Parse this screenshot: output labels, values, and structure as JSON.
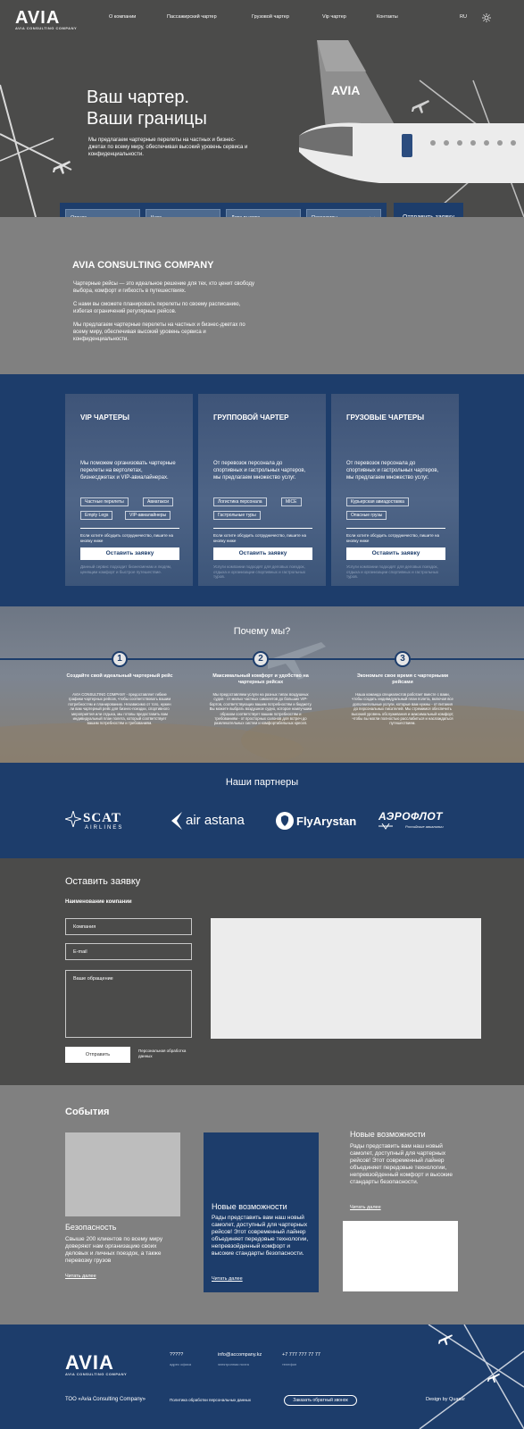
{
  "header": {
    "logo_text": "AVIA",
    "logo_sub": "AVIA CONSULTING COMPANY",
    "nav": [
      "О компании",
      "Пассажирский чартер",
      "Грузовой чартер",
      "Vip чартер",
      "Контакты"
    ],
    "lang": "RU"
  },
  "hero": {
    "title_line1": "Ваш чартер.",
    "title_line2": "Ваши границы",
    "subtitle": "Мы предлагаем чартерные перелеты на частных и бизнес-джетах по всему миру, обеспечивая высокий уровень сервиса и конфиденциальности.",
    "search": {
      "from": "Откуда",
      "to": "Куда",
      "date": "Дата вылета",
      "passengers": "Пассажиры",
      "submit": "Отправить заявку"
    }
  },
  "about": {
    "title": "AVIA CONSULTING COMPANY",
    "p1": "Чартерные рейсы — это идеальное решение для тех, кто ценит свободу выбора, комфорт и гибкость в путешествиях.",
    "p2": "С нами вы сможете планировать перелеты по своему расписанию, избегая ограничений регулярных рейсов.",
    "p3": "Мы предлагаем чартерные перелеты на частных и бизнес-джетах по всему миру, обеспечивая высокий уровень сервиса и конфиденциальности."
  },
  "services": [
    {
      "title": "VIP ЧАРТЕРЫ",
      "desc": "Мы поможем организовать чартерные перелеты на вертолетах, бизнесджетах и VIP-авиалайнерах.",
      "tags": [
        "Частные перелеты",
        "Авиатакси",
        "Empty Legs",
        "VIP-авиалайнеры"
      ],
      "note": "Если хотите обсудить сотрудничество, пишите на кнопку ниже",
      "button": "Оставить заявку",
      "footnote": "Данный сервис подходит бизнесменам и людям, ценящим комфорт и быстрое путешествие."
    },
    {
      "title": "ГРУППОВОЙ ЧАРТЕР",
      "desc": "От перевозок персонала до спортивных и гастрольных чартеров, мы предлагаем множество услуг.",
      "tags": [
        "Логистика персонала",
        "MICE",
        "Гастрольные туры"
      ],
      "note": "Если хотите обсудить сотрудничество, пишите на кнопку ниже",
      "button": "Оставить заявку",
      "footnote": "Услуги компании подходят для деловых поездок, отдыха и организации спортивных и гастрольных туров."
    },
    {
      "title": "ГРУЗОВЫЕ ЧАРТЕРЫ",
      "desc": "От перевозок персонала до спортивных и гастрольных чартеров, мы предлагаем множество услуг.",
      "tags": [
        "Курьерская авиадоставка",
        "Опасные грузы"
      ],
      "note": "Если хотите обсудить сотрудничество, пишите на кнопку ниже",
      "button": "Оставить заявку",
      "footnote": "Услуги компании подходят для деловых поездок, отдыха и организации спортивных и гастрольных туров."
    }
  ],
  "why": {
    "title": "Почему мы?",
    "items": [
      {
        "num": "1",
        "title": "Создайте свой идеальный чартерный рейс",
        "desc": "AVIA CONSULTING COMPANY - предоставляет гибкие графики чартерных рейсов, чтобы соответствовать вашим потребностям и планированию. Независимо от того, нужен ли вам чартерный рейс для бизнес-поездки, спортивного мероприятия или отдыха, мы готовы предоставить вам индивидуальный план полета, который соответствует вашим потребностям и требованиям."
      },
      {
        "num": "2",
        "title": "Максимальный комфорт и удобство на чартерных рейсах",
        "desc": "Мы предоставляем услуги на разных типах воздушных судов - от малых частных самолетов до больших VIP-бортов, соответствующих вашим потребностям и бюджету. Вы можете выбрать воздушное судно, которое наилучшим образом соответствует вашим потребностям и требованиям - от просторных салонов для встреч до развлекательных систем и комфортабельных кресел."
      },
      {
        "num": "3",
        "title": "Экономьте свое время с чартерными рейсами",
        "desc": "Наша команда специалистов работает вместе с вами, чтобы создать индивидуальный план полета, включая все дополнительные услуги, которые вам нужны - от питания до персональных писателей. Мы стремимся обеспечить высокий уровень обслуживания и максимальный комфорт, чтобы вы могли полностью расслабиться и наслаждаться путешествием."
      }
    ]
  },
  "partners": {
    "title": "Наши партнеры",
    "logos": [
      {
        "name": "SCAT",
        "sub": "AIRLINES"
      },
      {
        "name": "air astana",
        "sub": ""
      },
      {
        "name": "FlyArystan",
        "sub": ""
      },
      {
        "name": "АЭРОФЛОТ",
        "sub": "Российские авиалинии"
      }
    ]
  },
  "form": {
    "title": "Оставить заявку",
    "subtitle": "Наименование компании",
    "company_placeholder": "Компания",
    "email_placeholder": "E-mail",
    "message_placeholder": "Ваше обращение",
    "submit": "Отправить",
    "consent": "Персональная обработка данных"
  },
  "events": {
    "title": "События",
    "items": [
      {
        "title": "Безопасность",
        "text": "Свыше 200 клиентов по всему миру доверяют нам организацию своих деловых и личных поездок, а также перевозку грузов",
        "link": "Читать далее"
      },
      {
        "title": "Новые возможности",
        "text": "Рады представить вам наш новый самолет, доступный для чартерных рейсов! Этот современный лайнер объединяет передовые технологии, непревзойденный комфорт и высокие стандарты безопасности.",
        "link": "Читать далее"
      },
      {
        "title": "Новые возможности",
        "text": "Рады представить вам наш новый самолет, доступный для чартерных рейсов! Этот современный лайнер объединяет передовые технологии, непревзойденный комфорт и высокие стандарты безопасности.",
        "link": "Читать далее"
      }
    ]
  },
  "footer": {
    "address": "?????",
    "address_label": "адрес офиса",
    "email": "info@accompany.kz",
    "email_label": "электронная почта",
    "phone": "+7 777 777 77 77",
    "phone_label": "телефон",
    "company": "ТОО «Avia Consulting Company»",
    "policy": "Политика обработки персональных данных",
    "callback": "Заказать обратный звонок",
    "design": "Design by Quasar"
  },
  "colors": {
    "navy": "#1d3d6b",
    "dark_gray": "#4b4b4a",
    "mid_gray": "#808080",
    "light_panel": "#ececec"
  }
}
